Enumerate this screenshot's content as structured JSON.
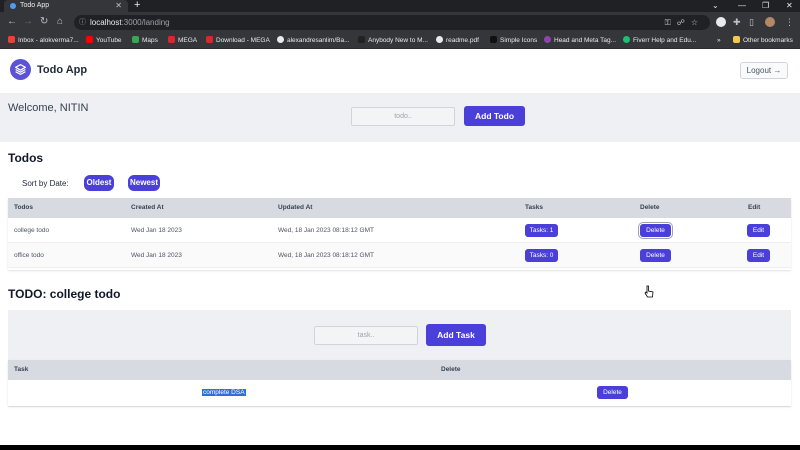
{
  "browser": {
    "tab_title": "Todo App",
    "url_host": "localhost",
    "url_path": ":3000/landing",
    "window_controls": [
      "⌄",
      "—",
      "❐",
      "✕"
    ],
    "bookmarks": [
      {
        "label": "Inbox - alokverma7...",
        "icon": "gmail-icon",
        "color": "#ea4335"
      },
      {
        "label": "YouTube",
        "icon": "youtube-icon",
        "color": "#ff0000"
      },
      {
        "label": "Maps",
        "icon": "maps-icon",
        "color": "#34a853"
      },
      {
        "label": "MEGA",
        "icon": "mega-icon",
        "color": "#d9272e"
      },
      {
        "label": "Download - MEGA",
        "icon": "mega-icon",
        "color": "#d9272e"
      },
      {
        "label": "alexandresanlim/Ba...",
        "icon": "github-icon",
        "color": "#e8eaed"
      },
      {
        "label": "Anybody New to M...",
        "icon": "site-icon",
        "color": "#222222"
      },
      {
        "label": "readme.pdf",
        "icon": "globe-icon",
        "color": "#e8eaed"
      },
      {
        "label": "Simple Icons",
        "icon": "simpleicons-icon",
        "color": "#111111"
      },
      {
        "label": "Head and Meta Tag...",
        "icon": "site-icon",
        "color": "#8e44ad"
      },
      {
        "label": "Fiverr Help and Edu...",
        "icon": "fiverr-icon",
        "color": "#1dbf73"
      }
    ],
    "other_bookmarks": "Other bookmarks"
  },
  "app": {
    "title": "Todo App",
    "logout_label": "Logout →",
    "welcome": "Welcome, NITIN",
    "todo_placeholder": "todo..",
    "add_todo_label": "Add Todo",
    "todos_heading": "Todos",
    "sort_label": "Sort by Date:",
    "sort_oldest": "Oldest",
    "sort_newest": "Newest",
    "todos_table": {
      "headers": [
        "Todos",
        "Created At",
        "Updated At",
        "Tasks",
        "Delete",
        "Edit"
      ],
      "rows": [
        {
          "name": "college todo",
          "created": "Wed Jan 18 2023",
          "updated": "Wed, 18 Jan 2023 08:18:12 GMT",
          "tasks": "Tasks: 1",
          "delete": "Delete",
          "edit": "Edit"
        },
        {
          "name": "office todo",
          "created": "Wed Jan 18 2023",
          "updated": "Wed, 18 Jan 2023 08:18:12 GMT",
          "tasks": "Tasks: 0",
          "delete": "Delete",
          "edit": "Edit"
        }
      ]
    },
    "detail_heading": "TODO: college todo",
    "task_placeholder": "task..",
    "add_task_label": "Add Task",
    "tasks_table": {
      "headers": [
        "Task",
        "Delete"
      ],
      "rows": [
        {
          "task": "complete DSA",
          "delete": "Delete"
        }
      ]
    }
  }
}
